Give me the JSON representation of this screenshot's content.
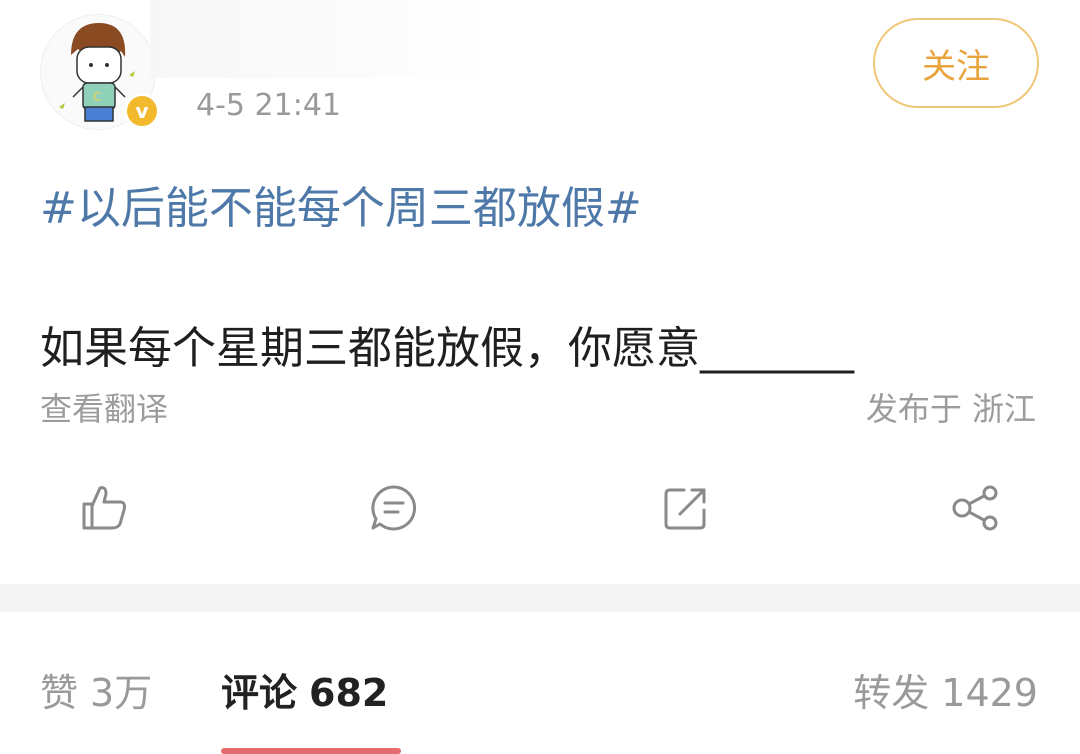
{
  "post": {
    "time": "4-5 21:41",
    "follow_label": "关注",
    "verified_badge": "v",
    "hashtag": "#以后能不能每个周三都放假#",
    "content": "如果每个星期三都能放假，你愿意_______",
    "translate_label": "查看翻译",
    "location": "发布于 浙江",
    "icons": {
      "like": "thumbs-up-icon",
      "comment": "comment-icon",
      "repost": "repost-icon",
      "share": "share-icon"
    }
  },
  "tabs": {
    "like_label": "赞",
    "like_count": "3万",
    "comment_label": "评论",
    "comment_count": "682",
    "repost_label": "转发",
    "repost_count": "1429"
  },
  "colors": {
    "hashtag": "#4d78a8",
    "follow_border": "#f0c779",
    "follow_text": "#e8a33d",
    "badge": "#f2b92c",
    "tab_indicator": "#e46c6c"
  }
}
